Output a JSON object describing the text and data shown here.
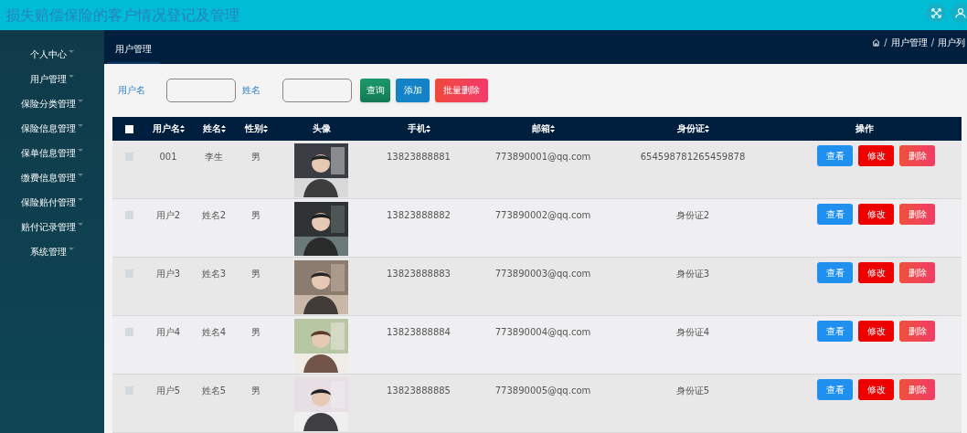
{
  "header": {
    "title": "损失赔偿保险的客户情况登记及管理"
  },
  "sidebar": {
    "items": [
      {
        "label": "个人中心"
      },
      {
        "label": "用户管理"
      },
      {
        "label": "保险分类管理"
      },
      {
        "label": "保险信息管理"
      },
      {
        "label": "保单信息管理"
      },
      {
        "label": "缴费信息管理"
      },
      {
        "label": "保险赔付管理"
      },
      {
        "label": "赔付记录管理"
      },
      {
        "label": "系统管理"
      }
    ]
  },
  "tabs": [
    {
      "label": "用户管理",
      "selected": true
    }
  ],
  "breadcrumb": [
    {
      "kind": "separator",
      "text": "/"
    },
    {
      "kind": "link",
      "text": "用户管理"
    },
    {
      "kind": "separator",
      "text": "/"
    },
    {
      "kind": "link",
      "text": "用户列"
    }
  ],
  "search": {
    "fields": [
      {
        "label": "用户名"
      },
      {
        "label": "姓名"
      }
    ],
    "buttons": [
      {
        "kind": "query",
        "label": "查询"
      },
      {
        "kind": "add",
        "label": "添加"
      },
      {
        "kind": "batch-delete",
        "label": "批量删除"
      }
    ]
  },
  "table": {
    "select_all_checked": false,
    "columns": [
      {
        "label": "用户名",
        "sortable": true
      },
      {
        "label": "姓名",
        "sortable": true
      },
      {
        "label": "性别",
        "sortable": true
      },
      {
        "label": "头像",
        "sortable": false
      },
      {
        "label": "手机",
        "sortable": true
      },
      {
        "label": "邮箱",
        "sortable": true
      },
      {
        "label": "身份证",
        "sortable": true
      },
      {
        "label": "操作",
        "sortable": false
      }
    ],
    "rows": [
      {
        "checked": false,
        "username": "001",
        "name": "李生",
        "sex": "男",
        "avatar": {
          "kind": "picture"
        },
        "phone": "13823888881",
        "email": "773890001@qq.com",
        "id_card": "654598781265459878",
        "actions": [
          "查看",
          "修改",
          "删除"
        ]
      },
      {
        "checked": false,
        "username": "用户2",
        "name": "姓名2",
        "sex": "男",
        "avatar": {
          "kind": "picture"
        },
        "phone": "13823888882",
        "email": "773890002@qq.com",
        "id_card": "身份证2",
        "actions": [
          "查看",
          "修改",
          "删除"
        ]
      },
      {
        "checked": false,
        "username": "用户3",
        "name": "姓名3",
        "sex": "男",
        "avatar": {
          "kind": "picture"
        },
        "phone": "13823888883",
        "email": "773890003@qq.com",
        "id_card": "身份证3",
        "actions": [
          "查看",
          "修改",
          "删除"
        ]
      },
      {
        "checked": false,
        "username": "用户4",
        "name": "姓名4",
        "sex": "男",
        "avatar": {
          "kind": "picture"
        },
        "phone": "13823888884",
        "email": "773890004@qq.com",
        "id_card": "身份证4",
        "actions": [
          "查看",
          "修改",
          "删除"
        ]
      },
      {
        "checked": false,
        "username": "用户5",
        "name": "姓名5",
        "sex": "男",
        "avatar": {
          "kind": "picture"
        },
        "phone": "13823888885",
        "email": "773890005@qq.com",
        "id_card": "身份证5",
        "actions": [
          "查看",
          "修改",
          "删除"
        ]
      }
    ]
  }
}
